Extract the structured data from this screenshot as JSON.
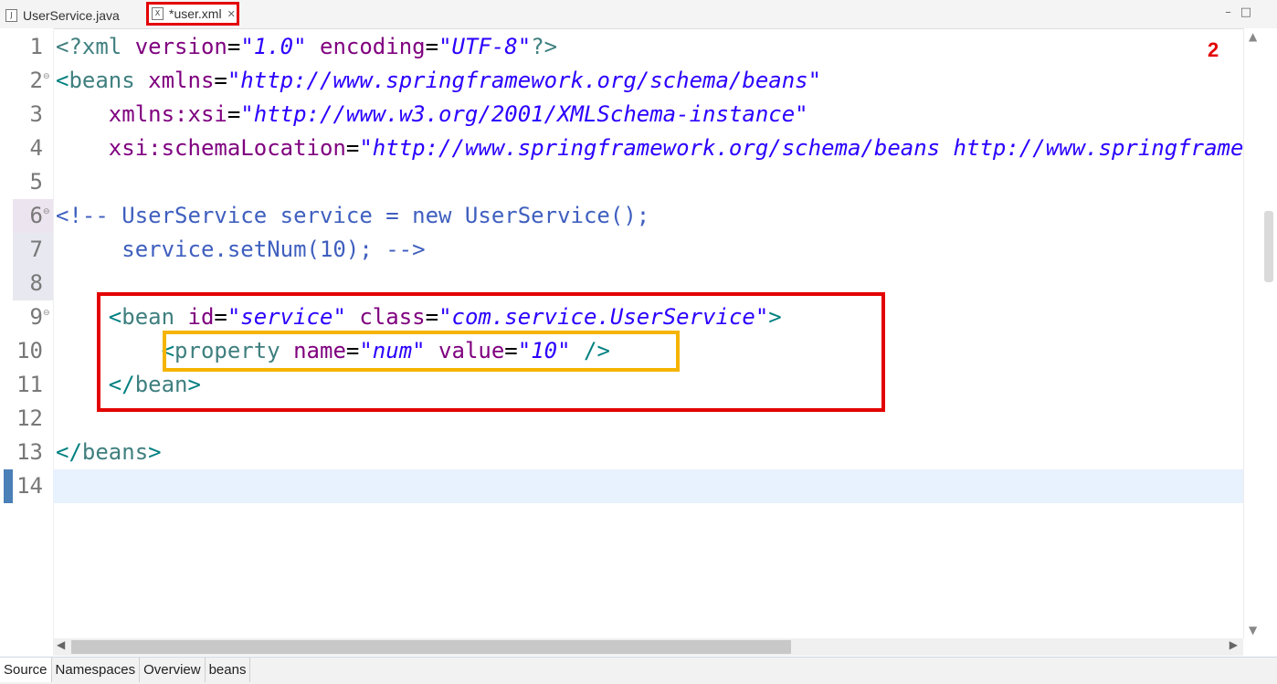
{
  "tabs": [
    {
      "label": "UserService.java",
      "icon": "java-file-icon",
      "active": false
    },
    {
      "label": "*user.xml",
      "icon": "xml-file-icon",
      "active": true
    }
  ],
  "annotation_label": "2",
  "lines": [
    {
      "num": "1",
      "tokens": [
        [
          "pi",
          "<?xml "
        ],
        [
          "attr",
          "version"
        ],
        [
          "eq",
          "="
        ],
        [
          "val",
          "\"1.0\""
        ],
        [
          "attr",
          " encoding"
        ],
        [
          "eq",
          "="
        ],
        [
          "val",
          "\"UTF-8\""
        ],
        [
          "pi",
          "?>"
        ]
      ]
    },
    {
      "num": "2",
      "tokens": [
        [
          "bracket",
          "<"
        ],
        [
          "tag",
          "beans "
        ],
        [
          "attr",
          "xmlns"
        ],
        [
          "eq",
          "="
        ],
        [
          "val",
          "\"http://www.springframework.org/schema/beans\""
        ]
      ]
    },
    {
      "num": "3",
      "tokens": [
        [
          "eq",
          "    "
        ],
        [
          "attr",
          "xmlns:xsi"
        ],
        [
          "eq",
          "="
        ],
        [
          "val",
          "\"http://www.w3.org/2001/XMLSchema-instance\""
        ]
      ]
    },
    {
      "num": "4",
      "tokens": [
        [
          "eq",
          "    "
        ],
        [
          "attr",
          "xsi:schemaLocation"
        ],
        [
          "eq",
          "="
        ],
        [
          "val",
          "\"http://www.springframework.org/schema/beans http://www.springframework.org/schema/beans/spring-beans.xsd\""
        ],
        [
          "bracket",
          ">"
        ]
      ]
    },
    {
      "num": "5",
      "tokens": []
    },
    {
      "num": "6",
      "tokens": [
        [
          "cmt",
          "<!-- UserService service = new UserService();"
        ]
      ]
    },
    {
      "num": "7",
      "tokens": [
        [
          "cmt",
          "     service.setNum(10); -->"
        ]
      ]
    },
    {
      "num": "8",
      "tokens": []
    },
    {
      "num": "9",
      "tokens": [
        [
          "eq",
          "    "
        ],
        [
          "bracket",
          "<"
        ],
        [
          "tag",
          "bean "
        ],
        [
          "attr",
          "id"
        ],
        [
          "eq",
          "="
        ],
        [
          "val",
          "\"service\""
        ],
        [
          "attr",
          " class"
        ],
        [
          "eq",
          "="
        ],
        [
          "val",
          "\"com.service.UserService\""
        ],
        [
          "bracket",
          ">"
        ]
      ]
    },
    {
      "num": "10",
      "tokens": [
        [
          "eq",
          "        "
        ],
        [
          "bracket",
          "<"
        ],
        [
          "tag",
          "property "
        ],
        [
          "attr",
          "name"
        ],
        [
          "eq",
          "="
        ],
        [
          "val",
          "\"num\""
        ],
        [
          "attr",
          " value"
        ],
        [
          "eq",
          "="
        ],
        [
          "val",
          "\"10\""
        ],
        [
          "bracket",
          " />"
        ]
      ]
    },
    {
      "num": "11",
      "tokens": [
        [
          "eq",
          "    "
        ],
        [
          "bracket",
          "</"
        ],
        [
          "tag",
          "bean"
        ],
        [
          "bracket",
          ">"
        ]
      ]
    },
    {
      "num": "12",
      "tokens": []
    },
    {
      "num": "13",
      "tokens": [
        [
          "bracket",
          "</"
        ],
        [
          "tag",
          "beans"
        ],
        [
          "bracket",
          ">"
        ]
      ]
    },
    {
      "num": "14",
      "tokens": []
    }
  ],
  "bottom_tabs": [
    {
      "label": "Source",
      "active": true
    },
    {
      "label": "Namespaces",
      "active": false
    },
    {
      "label": "Overview",
      "active": false
    },
    {
      "label": "beans",
      "active": false
    }
  ],
  "colors": {
    "annotation_red": "#e30000",
    "annotation_yellow": "#f5b400",
    "current_line": "#e8f2fe"
  }
}
